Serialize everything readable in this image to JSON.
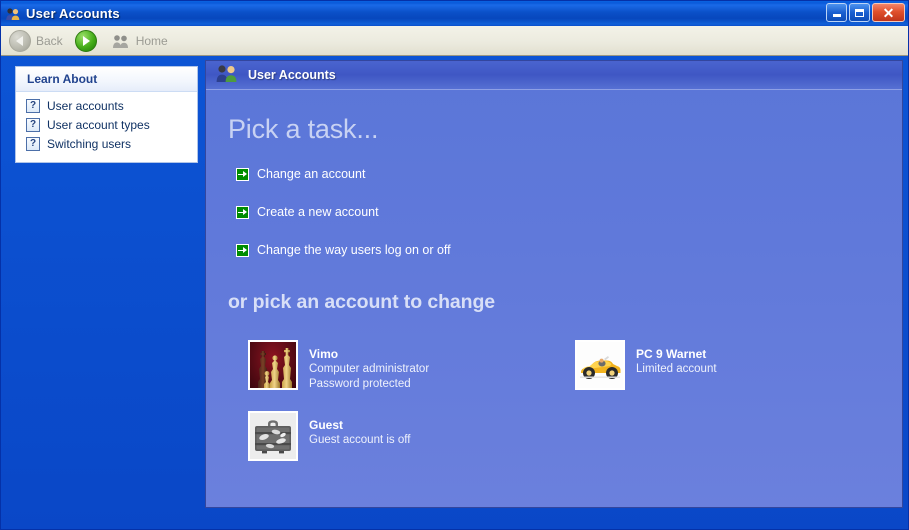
{
  "window": {
    "title": "User Accounts",
    "titlebar_icon": "user-accounts-icon",
    "controls": {
      "minimize": "Minimize",
      "maximize": "Maximize",
      "close": "Close"
    }
  },
  "toolbar": {
    "back_label": "Back",
    "back_icon": "back-arrow-icon",
    "forward_icon": "forward-arrow-icon",
    "home_label": "Home",
    "home_icon": "home-users-icon"
  },
  "sidebar": {
    "panel_title": "Learn About",
    "links": [
      {
        "label": "User accounts",
        "icon": "help-question-icon"
      },
      {
        "label": "User account types",
        "icon": "help-question-icon"
      },
      {
        "label": "Switching users",
        "icon": "help-question-icon"
      }
    ]
  },
  "content": {
    "header_title": "User Accounts",
    "header_icon": "two-users-icon",
    "pick_task_heading": "Pick a task...",
    "tasks": [
      {
        "label": "Change an account",
        "icon": "green-arrow-icon"
      },
      {
        "label": "Create a new account",
        "icon": "green-arrow-icon"
      },
      {
        "label": "Change the way users log on or off",
        "icon": "green-arrow-icon"
      }
    ],
    "pick_account_heading": "or pick an account to change",
    "accounts": [
      {
        "name": "Vimo",
        "line1": "Computer administrator",
        "line2": "Password protected",
        "picture": "chess-pieces-picture"
      },
      {
        "name": "PC 9 Warnet",
        "line1": "Limited account",
        "line2": "",
        "picture": "race-car-picture"
      },
      {
        "name": "Guest",
        "line1": "Guest account is off",
        "line2": "",
        "picture": "suitcase-picture"
      }
    ]
  },
  "colors": {
    "title_bar_blue": "#0a50c8",
    "content_blue": "#6079da",
    "panel_heading_blue": "#21438e",
    "task_arrow_green": "#008c00",
    "close_button_red": "#e0502c"
  }
}
